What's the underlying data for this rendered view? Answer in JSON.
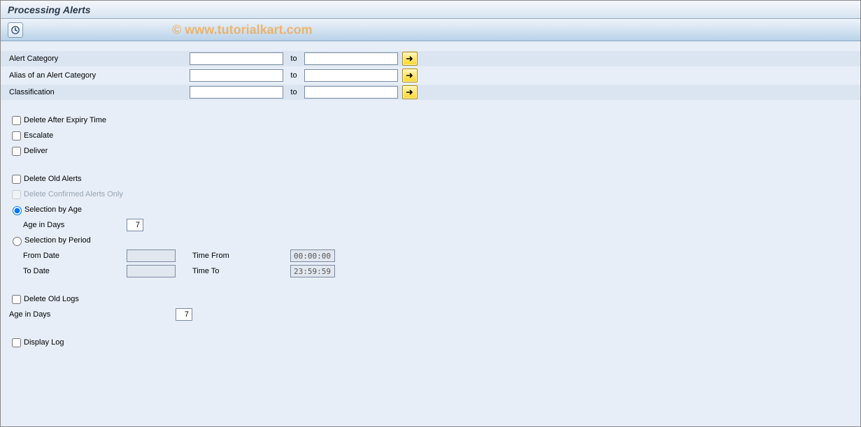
{
  "title": "Processing Alerts",
  "watermark": "© www.tutorialkart.com",
  "range": {
    "to_text": "to",
    "rows": [
      {
        "label": "Alert Category",
        "from": "",
        "to": ""
      },
      {
        "label": "Alias of an Alert Category",
        "from": "",
        "to": ""
      },
      {
        "label": "Classification",
        "from": "",
        "to": ""
      }
    ]
  },
  "chk_delete_expiry": "Delete After Expiry Time",
  "chk_escalate": "Escalate",
  "chk_deliver": "Deliver",
  "chk_delete_old_alerts": "Delete Old Alerts",
  "chk_delete_confirmed_only": "Delete Confirmed Alerts Only",
  "rad_sel_age": "Selection by Age",
  "age_in_days_label": "Age in Days",
  "age_in_days_value": "7",
  "rad_sel_period": "Selection by Period",
  "from_date_label": "From Date",
  "to_date_label": "To Date",
  "time_from_label": "Time From",
  "time_to_label": "Time To",
  "time_from_value": "00:00:00",
  "time_to_value": "23:59:59",
  "chk_delete_old_logs": "Delete Old Logs",
  "logs_age_label": "Age in Days",
  "logs_age_value": "7",
  "chk_display_log": "Display Log"
}
